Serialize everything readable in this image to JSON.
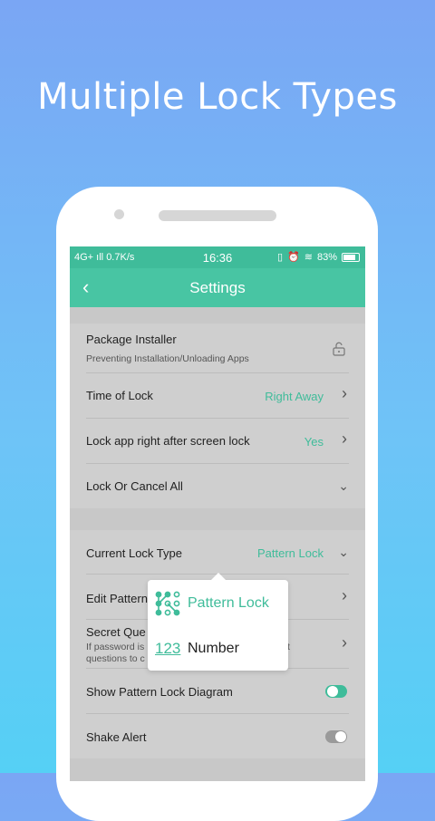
{
  "promo": {
    "headline": "Multiple Lock Types"
  },
  "statusbar": {
    "network": "4G+",
    "speed": "0.7K/s",
    "time": "16:36",
    "battery": "83%"
  },
  "header": {
    "title": "Settings",
    "back_icon": "back-chevron-icon"
  },
  "settings": {
    "package_installer": {
      "label": "Package Installer",
      "sub": "Preventing Installation/Unloading Apps"
    },
    "time_of_lock": {
      "label": "Time of Lock",
      "value": "Right Away"
    },
    "lock_after_screen": {
      "label": "Lock app right after screen lock",
      "value": "Yes"
    },
    "lock_or_cancel": {
      "label": "Lock Or Cancel All"
    },
    "current_lock_type": {
      "label": "Current Lock Type",
      "value": "Pattern Lock"
    },
    "edit_pattern": {
      "label": "Edit Pattern"
    },
    "secret_question": {
      "label": "Secret Que",
      "sub1": "If password is",
      "sub1_tail": "t",
      "sub2": "questions to c"
    },
    "show_pattern": {
      "label": "Show Pattern Lock Diagram",
      "enabled": true
    },
    "shake_alert": {
      "label": "Shake Alert",
      "enabled": false
    }
  },
  "popup": {
    "options": [
      {
        "label": "Pattern Lock",
        "icon": "pattern-grid-icon",
        "selected": true
      },
      {
        "label": "Number",
        "icon": "123",
        "selected": false
      }
    ]
  },
  "colors": {
    "accent": "#3fbc9a",
    "toolbar": "#48c5a3",
    "dim": "#cfcfcf"
  }
}
